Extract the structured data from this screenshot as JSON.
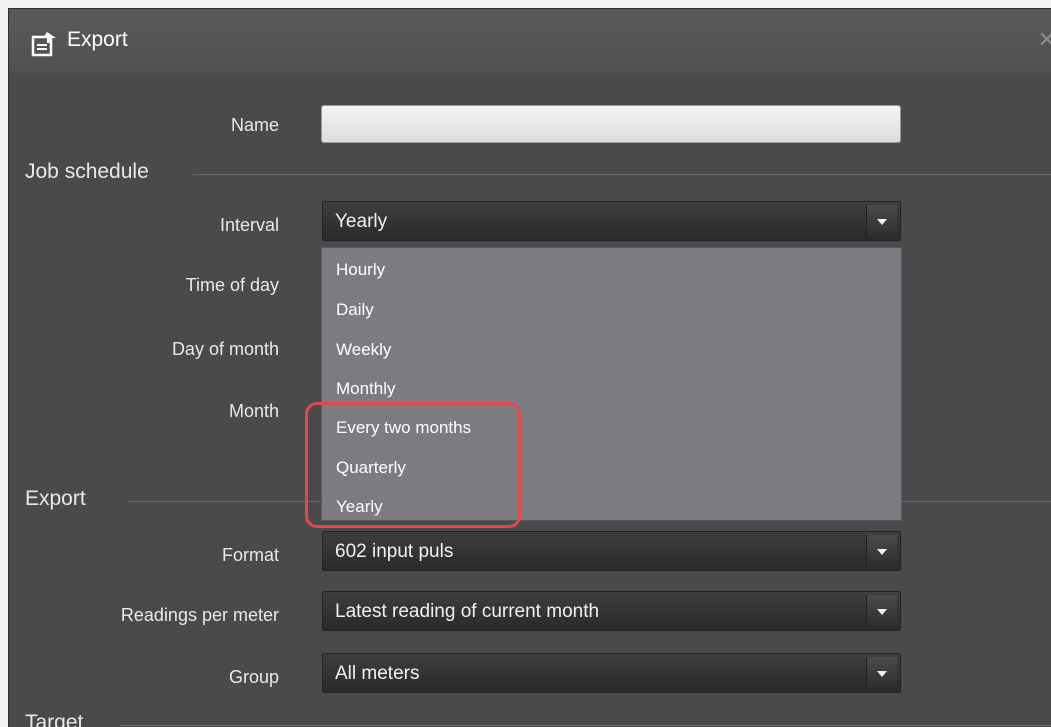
{
  "window": {
    "title": "Export"
  },
  "fields": {
    "name_label": "Name",
    "name_value": "",
    "interval_label": "Interval",
    "time_of_day_label": "Time of day",
    "day_of_month_label": "Day of month",
    "month_label": "Month",
    "format_label": "Format",
    "readings_label": "Readings per meter",
    "group_label": "Group"
  },
  "sections": {
    "job_schedule": "Job schedule",
    "export": "Export",
    "target": "Target"
  },
  "interval": {
    "selected": "Yearly",
    "options": [
      "Hourly",
      "Daily",
      "Weekly",
      "Monthly",
      "Every two months",
      "Quarterly",
      "Yearly"
    ]
  },
  "format": {
    "selected": "602 input puls"
  },
  "readings": {
    "selected": "Latest reading of current month"
  },
  "group": {
    "selected": "All meters"
  },
  "colors": {
    "highlight": "#e8474a",
    "dialog_bg": "#4a4a4c",
    "dropdown_bg": "#7b7c7f"
  },
  "icons": {
    "title": "export-icon",
    "close": "close-icon"
  }
}
